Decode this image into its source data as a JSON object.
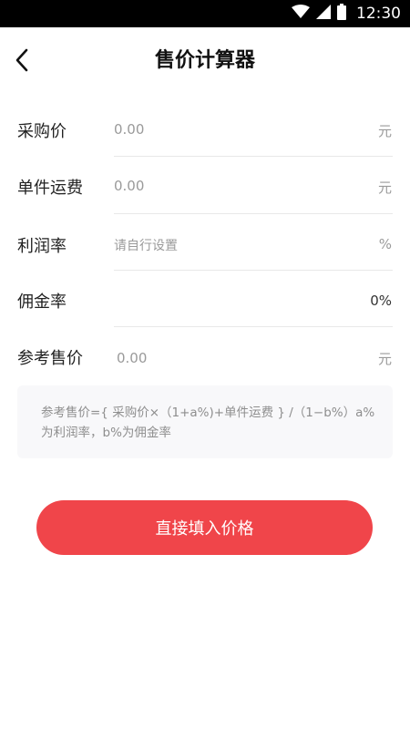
{
  "status_bar": {
    "time": "12:30",
    "icons": [
      "wifi-icon",
      "signal-icon",
      "battery-icon"
    ]
  },
  "header": {
    "back_icon": "chevron-left-icon",
    "title": "售价计算器"
  },
  "form": {
    "purchase_price": {
      "label": "采购价",
      "value": "0.00",
      "unit": "元"
    },
    "shipping_per_unit": {
      "label": "单件运费",
      "value": "0.00",
      "unit": "元"
    },
    "profit_rate": {
      "label": "利润率",
      "placeholder": "请自行设置",
      "unit": "%"
    },
    "commission_rate": {
      "label": "佣金率",
      "value": "0%"
    },
    "reference_price": {
      "label": "参考售价",
      "value": "0.00",
      "unit": "元"
    }
  },
  "formula": {
    "text": "参考售价={ 采购价×（1+a%)+单件运费 } /（1−b%）a%为利润率，b%为佣金率"
  },
  "actions": {
    "fill_price_label": "直接填入价格"
  },
  "colors": {
    "accent": "#f0454a",
    "status_bar": "#000000",
    "placeholder": "#9a9a9a",
    "divider": "#e8e8e8",
    "formula_bg": "#f8f8fa"
  }
}
